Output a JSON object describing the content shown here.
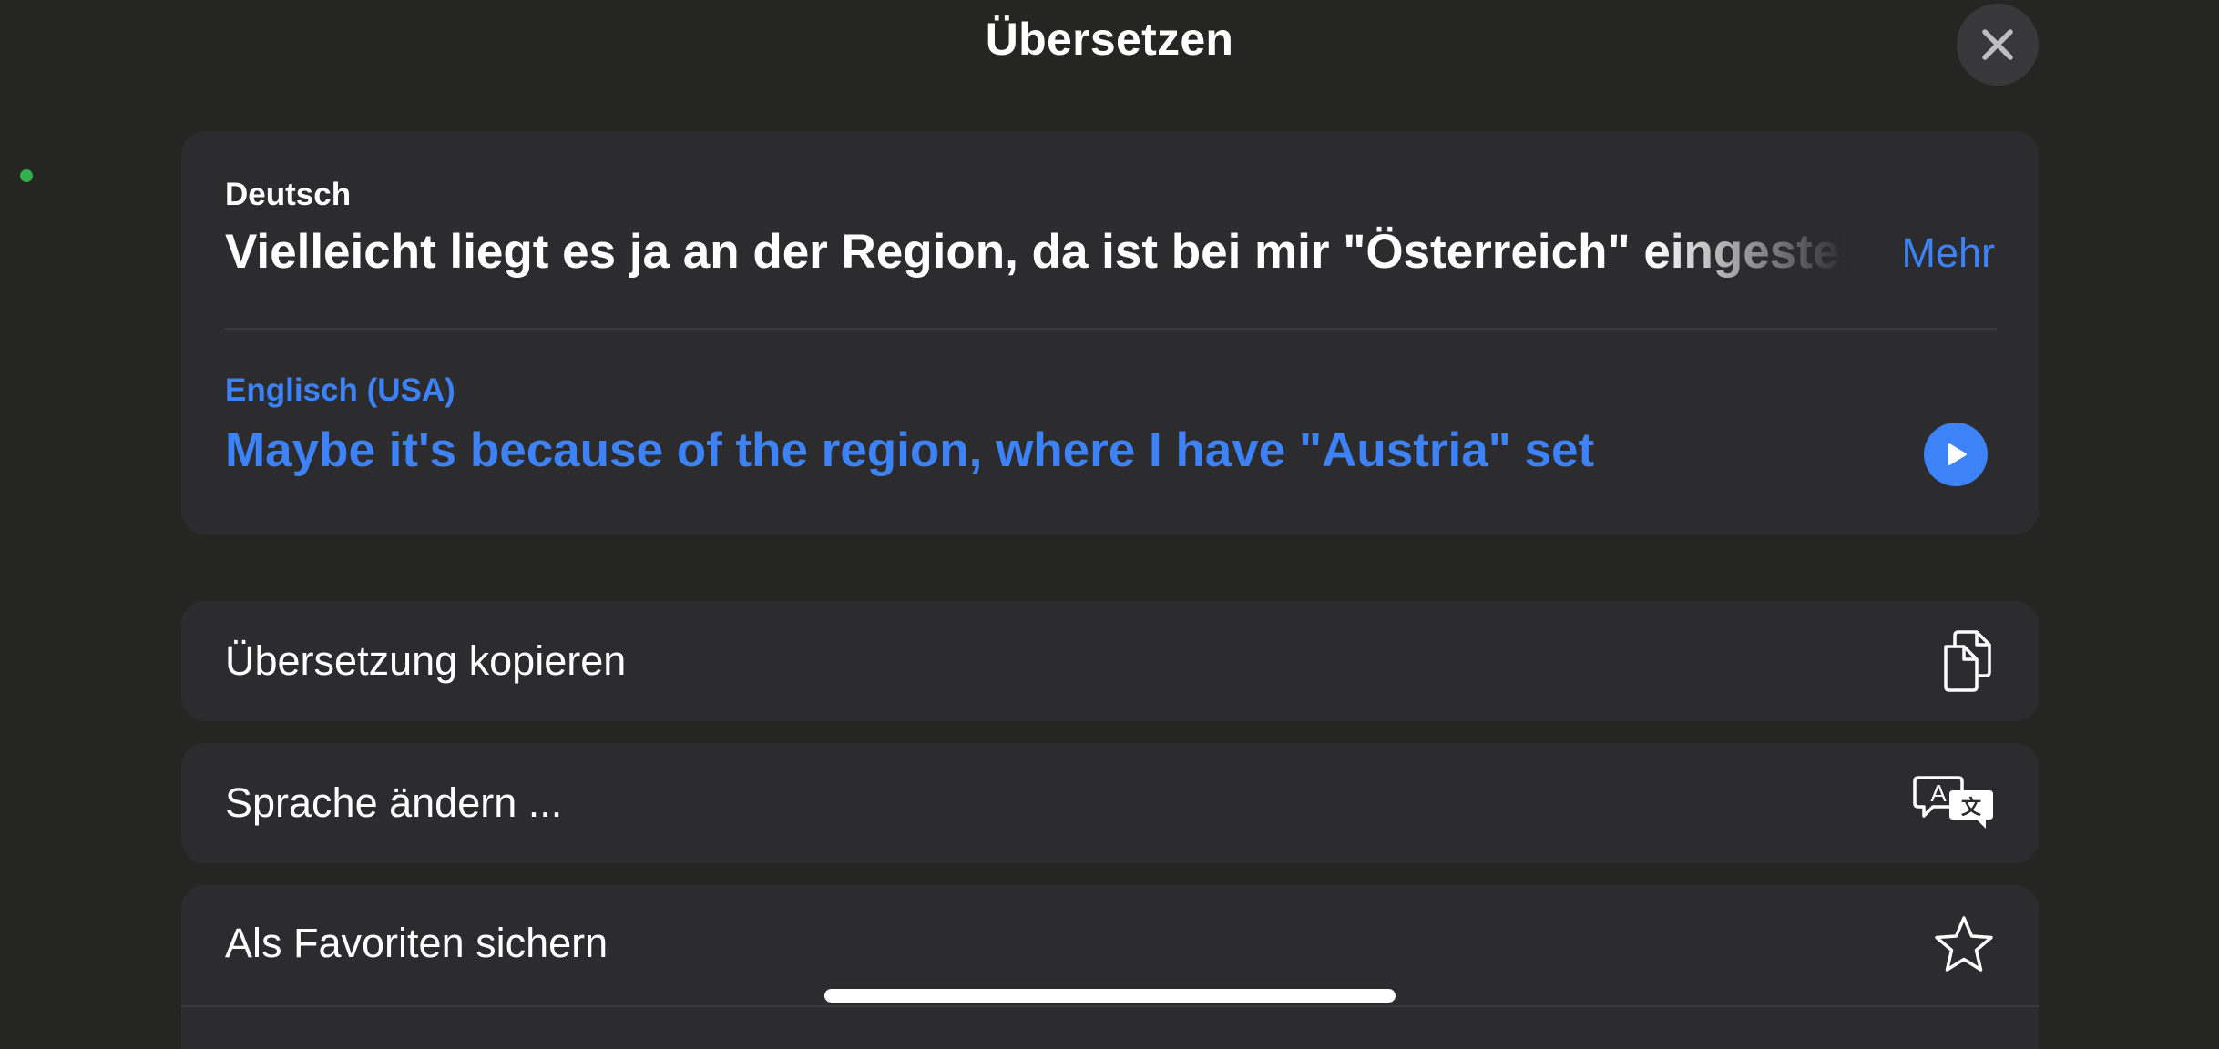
{
  "sheet": {
    "title": "Übersetzen",
    "close_icon": "xmark"
  },
  "translation": {
    "source_language": "Deutsch",
    "source_text": "Vielleicht liegt es ja an der Region, da ist bei mir \"Österreich\" eingestellt",
    "more_label": "Mehr",
    "target_language": "Englisch (USA)",
    "target_text": "Maybe it's because of the region, where I have \"Austria\" set",
    "play_icon": "play-fill"
  },
  "actions": [
    {
      "label": "Übersetzung kopieren",
      "icon": "doc-on-doc"
    },
    {
      "label": "Sprache ändern ...",
      "icon": "translate"
    },
    {
      "label": "Als Favoriten sichern",
      "icon": "star"
    }
  ],
  "colors": {
    "background": "#252523",
    "card": "#2c2c2e",
    "accent": "#3d82f6",
    "status_dot": "#30b14c"
  }
}
